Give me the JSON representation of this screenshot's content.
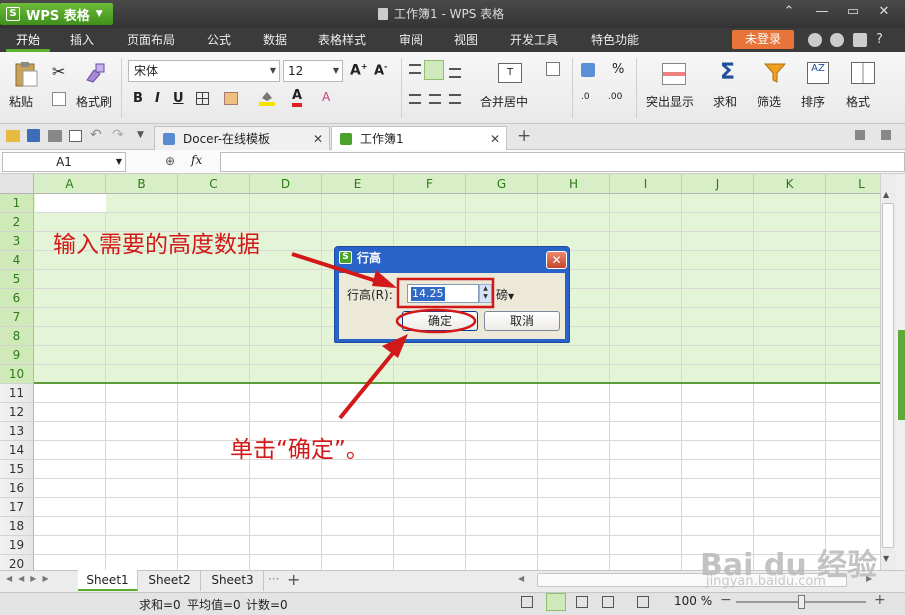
{
  "app": {
    "name": "WPS 表格",
    "logo": "S",
    "doc_title": "工作簿1 - WPS 表格"
  },
  "menu": {
    "items": [
      "开始",
      "插入",
      "页面布局",
      "公式",
      "数据",
      "表格样式",
      "审阅",
      "视图",
      "开发工具",
      "特色功能"
    ],
    "login": "未登录",
    "help": "?"
  },
  "ribbon": {
    "paste": "粘贴",
    "format_painter": "格式刷",
    "font_name": "宋体",
    "font_size": "12",
    "merge_center": "合并居中",
    "highlight": "突出显示",
    "sum": "求和",
    "filter": "筛选",
    "sort": "排序",
    "format": "格式",
    "percent": "%"
  },
  "doc_tabs": [
    {
      "label": "Docer-在线模板"
    },
    {
      "label": "工作簿1"
    }
  ],
  "formula_bar": {
    "name_box": "A1",
    "fx": "fx",
    "value": ""
  },
  "grid": {
    "columns": [
      "A",
      "B",
      "C",
      "D",
      "E",
      "F",
      "G",
      "H",
      "I",
      "J",
      "K",
      "L"
    ],
    "rows": [
      "1",
      "2",
      "3",
      "4",
      "5",
      "6",
      "7",
      "8",
      "9",
      "10",
      "11",
      "12",
      "13",
      "14",
      "15",
      "16",
      "17",
      "18",
      "19",
      "20"
    ],
    "selected_rows": "1-10"
  },
  "sheets": [
    "Sheet1",
    "Sheet2",
    "Sheet3"
  ],
  "sheets_more": "···",
  "status": {
    "sum": "求和=0",
    "avg": "平均值=0",
    "count": "计数=0",
    "zoom": "100 %"
  },
  "dialog": {
    "title": "行高",
    "label": "行高(R):",
    "value": "14.25",
    "unit": "磅",
    "ok": "确定",
    "cancel": "取消"
  },
  "annotations": {
    "top": "输入需要的高度数据",
    "bottom": "单击“确定”。"
  },
  "watermark": {
    "main": "Bai du 经验",
    "sub": "jingyan.baidu.com"
  },
  "colors": {
    "accent_green": "#5bb030",
    "selection": "#e4f4d7",
    "annotation_red": "#d21818",
    "dialog_blue": "#2a63c8"
  }
}
